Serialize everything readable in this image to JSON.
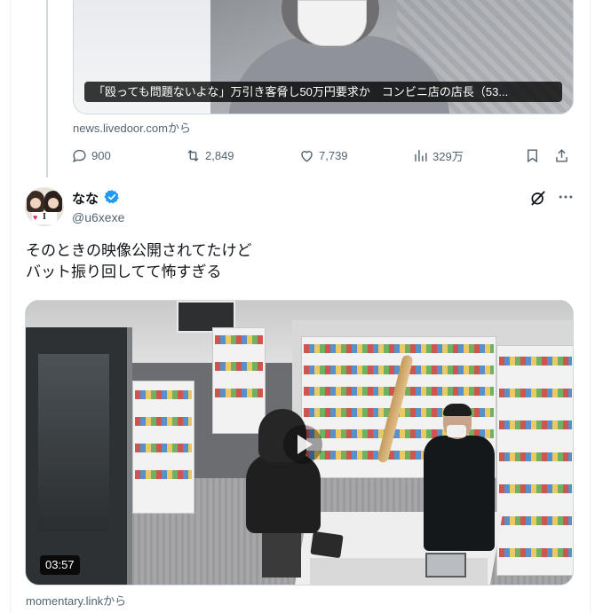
{
  "quoted_card": {
    "caption": "「殴っても問題ないよな」万引き客脅し50万円要求か　コンビニ店の店長（53..."
  },
  "source_1": "news.livedoor.comから",
  "actions": {
    "reply_count": "900",
    "retweet_count": "2,849",
    "like_count": "7,739",
    "view_count": "329万"
  },
  "tweet": {
    "display_name": "なな",
    "handle": "@u6xexe",
    "text_lines": [
      "そのときの映像公開されてたけど",
      "バット振り回してて怖すぎる"
    ],
    "video_duration": "03:57",
    "source": "momentary.linkから"
  },
  "colors": {
    "text_primary": "#0f1419",
    "text_secondary": "#536471",
    "border": "#cfd9de",
    "verified_blue": "#1d9bf0"
  },
  "icons": [
    "reply-icon",
    "retweet-icon",
    "like-icon",
    "views-icon",
    "bookmark-icon",
    "share-icon",
    "verified-badge-icon",
    "grok-icon",
    "more-icon",
    "play-icon"
  ]
}
